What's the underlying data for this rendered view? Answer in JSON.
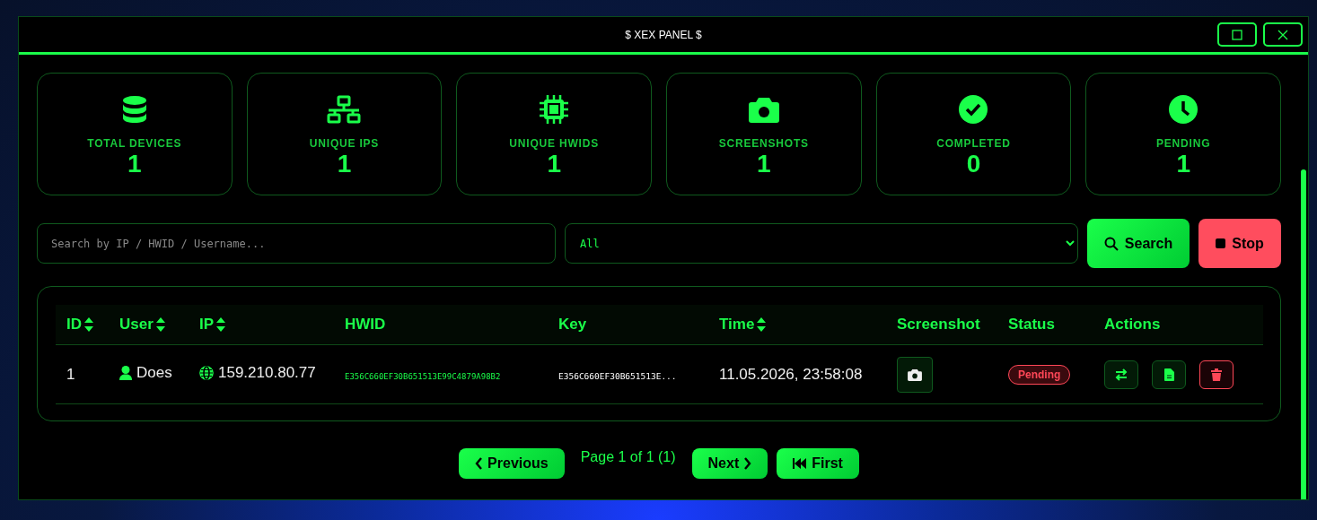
{
  "window": {
    "title": "$ XEX PANEL $"
  },
  "stats": [
    {
      "label": "TOTAL DEVICES",
      "value": "1"
    },
    {
      "label": "UNIQUE IPS",
      "value": "1"
    },
    {
      "label": "UNIQUE HWIDS",
      "value": "1"
    },
    {
      "label": "SCREENSHOTS",
      "value": "1"
    },
    {
      "label": "COMPLETED",
      "value": "0"
    },
    {
      "label": "PENDING",
      "value": "1"
    }
  ],
  "search": {
    "placeholder": "Search by IP / HWID / Username...",
    "filter": "All",
    "search_button": "Search",
    "stop_button": "Stop"
  },
  "table": {
    "columns": [
      {
        "label": "ID",
        "sortable": true
      },
      {
        "label": "User",
        "sortable": true
      },
      {
        "label": "IP",
        "sortable": true
      },
      {
        "label": "HWID",
        "sortable": false
      },
      {
        "label": "Key",
        "sortable": false
      },
      {
        "label": "Time",
        "sortable": true
      },
      {
        "label": "Screenshot",
        "sortable": false
      },
      {
        "label": "Status",
        "sortable": false
      },
      {
        "label": "Actions",
        "sortable": false
      }
    ],
    "rows": [
      {
        "id": "1",
        "user": "Does",
        "ip": "159.210.80.77",
        "hwid": "E356C660EF30B651513E99C4879A98B2",
        "key": "E356C660EF30B651513E...",
        "time": "11.05.2026, 23:58:08",
        "status": "Pending",
        "actions": [
          {
            "kind": "swap"
          },
          {
            "kind": "file"
          },
          {
            "kind": "delete"
          }
        ]
      }
    ]
  },
  "pagination": {
    "previous": "Previous",
    "info": "Page 1 of 1 (1)",
    "next": "Next",
    "first": "First"
  }
}
